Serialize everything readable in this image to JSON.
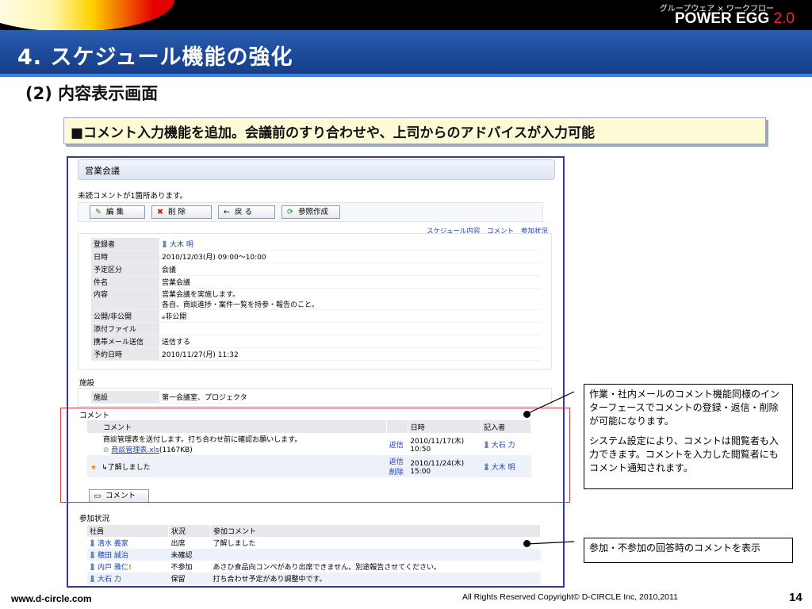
{
  "branding": {
    "tagline": "グループウェア × ワークフロー",
    "product": "POWER EGG",
    "version": "2.0"
  },
  "slide": {
    "title": "4. スケジュール機能の強化",
    "subtitle": "(2) 内容表示画面",
    "feature": "■コメント入力機能を追加。会議前のすり合わせや、上司からのアドバイスが入力可能"
  },
  "app": {
    "header_title": "営業会議",
    "notice": "未読コメントが1箇所あります。",
    "buttons": [
      {
        "label": "編 集",
        "icon": "pencil-icon"
      },
      {
        "label": "削 除",
        "icon": "delete-x-icon"
      },
      {
        "label": "戻 る",
        "icon": "back-arrow-icon"
      },
      {
        "label": "参照作成",
        "icon": "copy-create-icon"
      }
    ],
    "links": [
      "スケジュール内容",
      "コメント",
      "参加状況"
    ],
    "details": [
      {
        "label": "登録者",
        "value": "大木 明",
        "person": true
      },
      {
        "label": "日時",
        "value": "2010/12/03(月) 09:00〜10:00"
      },
      {
        "label": "予定区分",
        "value": "会議"
      },
      {
        "label": "件名",
        "value": "営業会議"
      },
      {
        "label": "内容",
        "value": "営業会議を実施します。",
        "value2": "各自、商談進捗・案件一覧を持参・報告のこと。"
      },
      {
        "label": "公開/非公開",
        "value": "非公開"
      },
      {
        "label": "添付ファイル",
        "value": ""
      },
      {
        "label": "携帯メール送信",
        "value": "送信する"
      },
      {
        "label": "予約日時",
        "value": "2010/11/27(月) 11:32"
      }
    ],
    "facility_section": "施設",
    "facility": {
      "label": "施設",
      "value": "第一会議室、プロジェクタ"
    },
    "comment_section": "コメント",
    "comment_headers": [
      "コメント",
      "日時",
      "記入者"
    ],
    "comments": [
      {
        "text": "商談管理表を送付します。打ち合わせ前に確認お願いします。",
        "attachment": "商談管理表.xls",
        "size": "(1167KB)",
        "action1": "返信",
        "date": "2010/11/17(木)",
        "time": "10:50",
        "author": "大石 力"
      },
      {
        "text": "↳了解しました",
        "action1": "返信",
        "action2": "削除",
        "date": "2010/11/24(木)",
        "time": "15:00",
        "author": "大木 明"
      }
    ],
    "comment_button": "コメント",
    "participation_section": "参加状況",
    "participation_headers": [
      "社員",
      "状況",
      "参加コメント"
    ],
    "participants": [
      {
        "name": "清水 義家",
        "status": "出席",
        "comment": "了解しました"
      },
      {
        "name": "穂田 誠治",
        "status": "未確認",
        "comment": ""
      },
      {
        "name": "内戸 雅仁",
        "status": "不参加",
        "comment": "あさひ食品向コンペがあり出席できません。別途報告させてください。"
      },
      {
        "name": "大石 力",
        "status": "保留",
        "comment": "打ち合わせ予定があり調整中です。"
      }
    ]
  },
  "callouts": {
    "first_para": "作業・社内メールのコメント機能同様のインターフェースでコメントの登録・返信・削除が可能になります。",
    "second_para": "システム設定により、コメントは閲覧者も入力できます。コメントを入力した閲覧者にもコメント通知されます。",
    "second_box": "参加・不参加の回答時のコメントを表示"
  },
  "footer": {
    "url": "www.d-circle.com",
    "copyright": "All Rights Reserved Copyright© D-CIRCLE Inc, 2010,2011",
    "page": "14"
  },
  "colors": {
    "title_bar": "#1d4a98",
    "highlight_box": "#e53a3a",
    "frame": "#3333cc",
    "link": "#1a3fb8"
  }
}
